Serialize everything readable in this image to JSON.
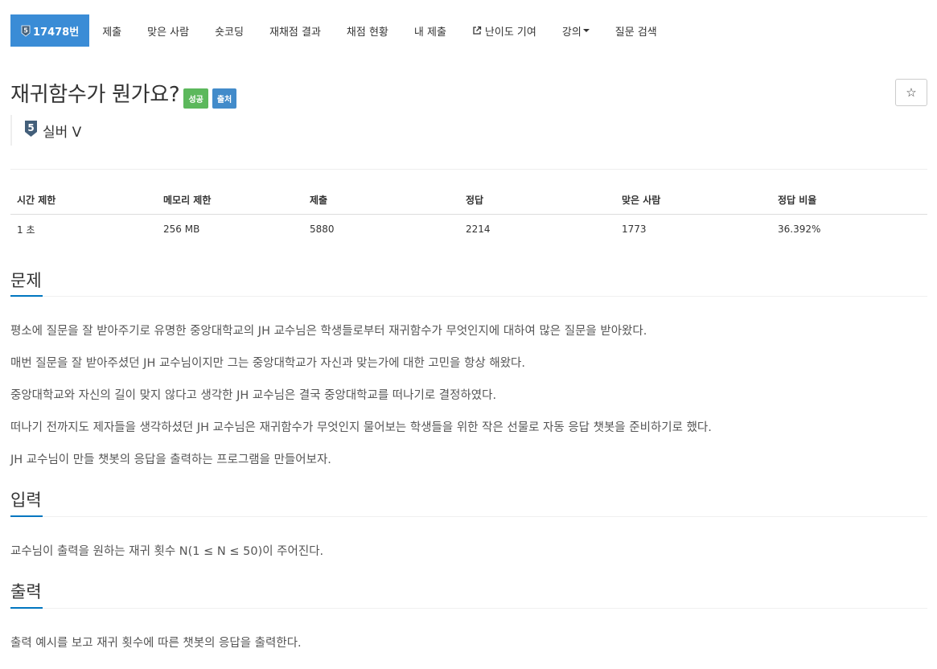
{
  "nav": {
    "problem_tab": "17478번",
    "items": [
      "제출",
      "맞은 사람",
      "숏코딩",
      "재채점 결과",
      "채점 현황",
      "내 제출",
      "난이도 기여",
      "강의",
      "질문 검색"
    ]
  },
  "problem": {
    "title": "재귀함수가 뭔가요?",
    "labels": [
      "성공",
      "출처"
    ],
    "star": "☆",
    "tier": "실버 V",
    "tier_num": "5"
  },
  "info": {
    "headers": [
      "시간 제한",
      "메모리 제한",
      "제출",
      "정답",
      "맞은 사람",
      "정답 비율"
    ],
    "values": [
      "1 초",
      "256 MB",
      "5880",
      "2214",
      "1773",
      "36.392%"
    ]
  },
  "sections": {
    "description_title": "문제",
    "description": [
      "평소에 질문을 잘 받아주기로 유명한 중앙대학교의 JH 교수님은 학생들로부터 재귀함수가 무엇인지에 대하여 많은 질문을 받아왔다.",
      "매번 질문을 잘 받아주셨던 JH 교수님이지만 그는 중앙대학교가 자신과 맞는가에 대한 고민을 항상 해왔다.",
      "중앙대학교와 자신의 길이 맞지 않다고 생각한 JH 교수님은 결국 중앙대학교를 떠나기로 결정하였다.",
      "떠나기 전까지도 제자들을 생각하셨던 JH 교수님은 재귀함수가 무엇인지 물어보는 학생들을 위한 작은 선물로 자동 응답 챗봇을 준비하기로 했다.",
      "JH 교수님이 만들 챗봇의 응답을 출력하는 프로그램을 만들어보자."
    ],
    "input_title": "입력",
    "input": "교수님이 출력을 원하는 재귀 횟수 N(1 ≤ N ≤ 50)이 주어진다.",
    "output_title": "출력",
    "output": "출력 예시를 보고 재귀 횟수에 따른 챗봇의 응답을 출력한다."
  },
  "colors": {
    "accent": "#3a8cd6",
    "success": "#5cb85c",
    "source": "#428bca",
    "tier_silver": "#435f7a",
    "section_underline": "#0076c0"
  },
  "icons": {
    "tier": "silver-tier-icon",
    "external": "external-link-icon",
    "caret": "caret-down-icon",
    "star": "star-outline-icon"
  }
}
